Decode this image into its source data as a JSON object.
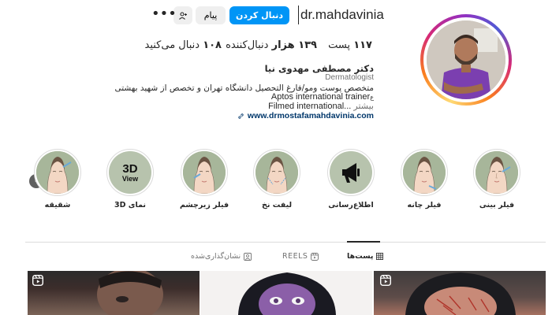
{
  "profile": {
    "username": "dr.mahdavinia",
    "follow_label": "دنبال کردن",
    "message_label": "پیام",
    "more_label": "•••",
    "stats": {
      "posts_count": "۱۱۷",
      "posts_label": "پست",
      "followers_count": "۱۳۹ هزار",
      "followers_label": "دنبال‌کننده",
      "following_count": "۱۰۸",
      "following_label": "دنبال می‌کنید"
    },
    "full_name": "دکتر مصطفی مهدوی نیا",
    "category": "Dermatologist",
    "bio_line1": "متخصص پوست ومو/فارغ التحصیل دانشگاه تهران و تخصص از شهید بهشتی",
    "bio_line2": "Aptos international trainer",
    "bio_line2_suffix": "ع",
    "bio_line3": "Filmed international...",
    "more_link": "بیشتر",
    "website": "www.drmostafamahdavinia.com"
  },
  "highlights": [
    {
      "label": "فیلر بینی",
      "icon": "face-illustration-icon"
    },
    {
      "label": "فیلر چانه",
      "icon": "face-illustration-icon"
    },
    {
      "label": "اطلاع‌رسانی",
      "icon": "megaphone-icon"
    },
    {
      "label": "لیفت نخ",
      "icon": "face-illustration-icon"
    },
    {
      "label": "فیلر زیرچشم",
      "icon": "face-illustration-icon"
    },
    {
      "label": "نمای 3D",
      "icon": "3d-view-icon",
      "text_top": "3D",
      "text_bottom": "View"
    },
    {
      "label": "شقیقه",
      "icon": "face-illustration-icon"
    }
  ],
  "tabs": [
    {
      "label": "پست‌ها",
      "icon": "grid-icon",
      "active": true
    },
    {
      "label": "REELS",
      "icon": "reels-icon",
      "active": false
    },
    {
      "label": "نشان‌گذاری‌شده",
      "icon": "tagged-icon",
      "active": false
    }
  ],
  "colors": {
    "primary_button": "#0095f6",
    "secondary_button": "#efefef",
    "link": "#00376b",
    "muted_text": "#737373",
    "highlight_bg": "#a7b69a"
  }
}
